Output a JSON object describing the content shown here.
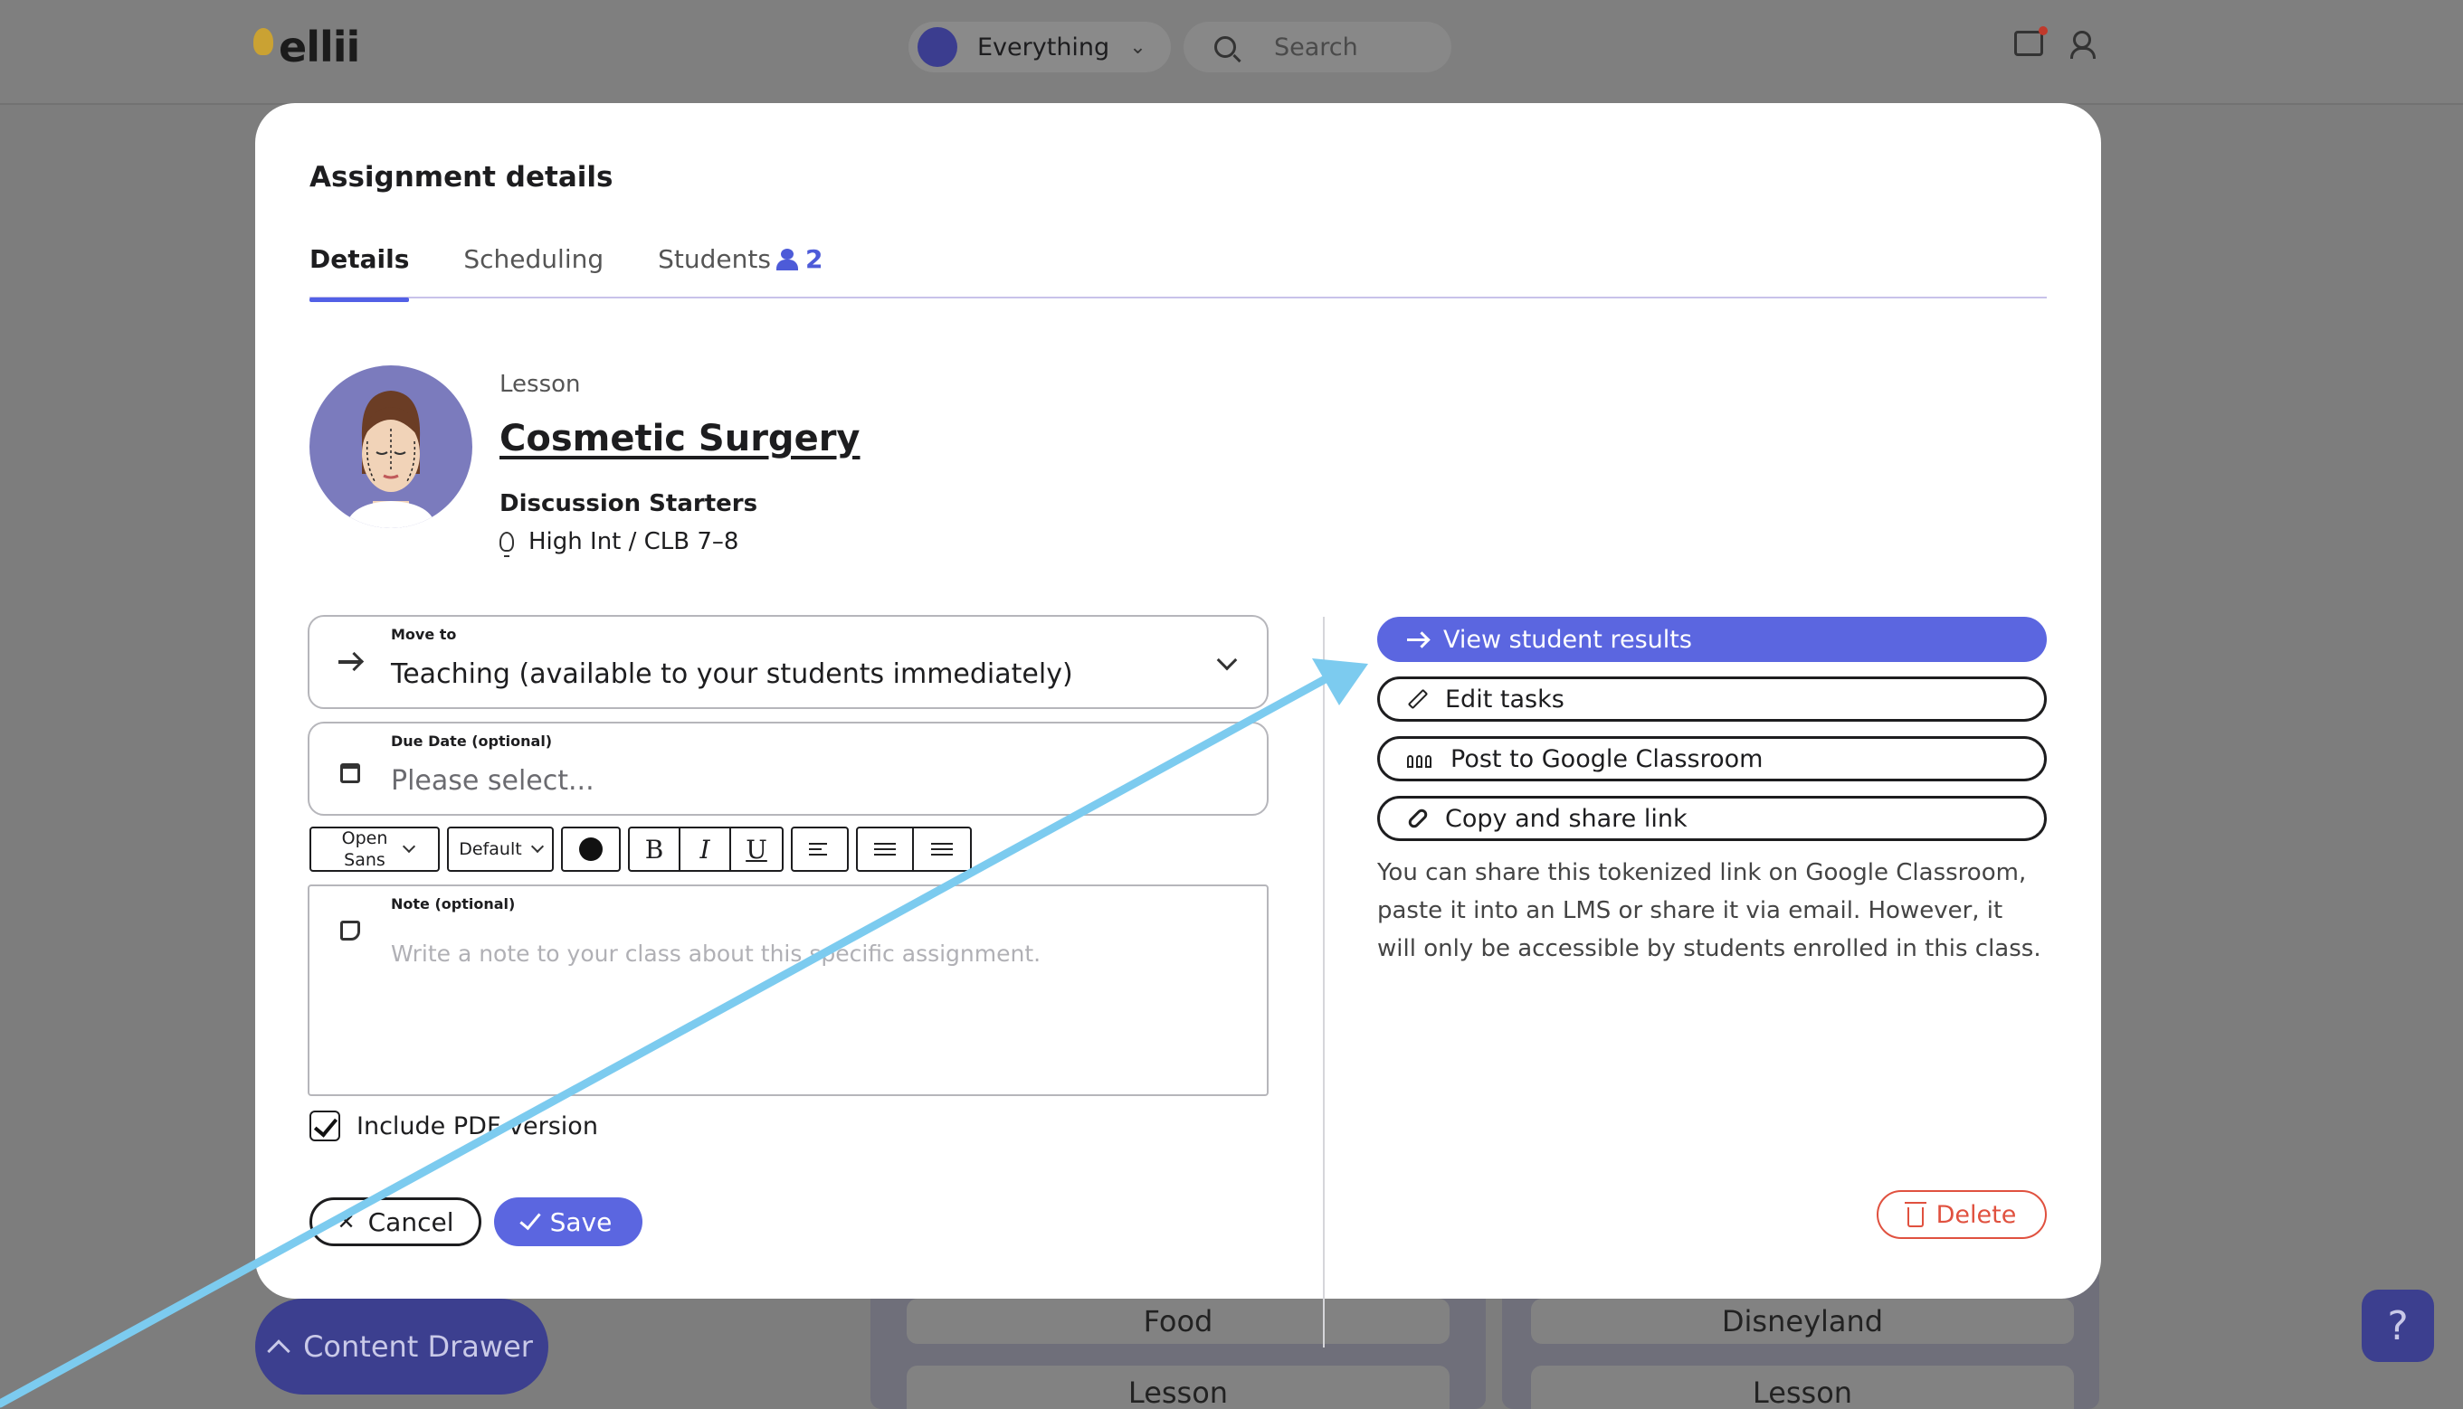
{
  "header": {
    "logo_text": "ellii",
    "scope_label": "Everything",
    "search_placeholder": "Search"
  },
  "background": {
    "cards": [
      "Food",
      "Disneyland",
      "Lesson",
      "Lesson"
    ],
    "content_drawer_label": "Content Drawer",
    "help_label": "?"
  },
  "modal": {
    "title": "Assignment details",
    "tabs": [
      {
        "label": "Details",
        "active": true
      },
      {
        "label": "Scheduling",
        "active": false
      },
      {
        "label": "Students",
        "count": "2",
        "active": false
      }
    ],
    "lesson": {
      "kind": "Lesson",
      "title": "Cosmetic Surgery",
      "category": "Discussion Starters",
      "level": "High Int / CLB 7–8"
    },
    "move_to": {
      "label": "Move to",
      "value": "Teaching (available to your students immediately)"
    },
    "due_date": {
      "label": "Due Date (optional)",
      "placeholder": "Please select..."
    },
    "toolbar": {
      "font_family": "Open Sans",
      "font_size": "Default",
      "bold": "B",
      "italic": "I",
      "underline": "U"
    },
    "note": {
      "label": "Note (optional)",
      "placeholder": "Write a note to your class about this specific assignment."
    },
    "include_pdf": {
      "label": "Include PDF version",
      "checked": true
    },
    "cancel_label": "Cancel",
    "save_label": "Save",
    "actions": {
      "view_results": "View student results",
      "edit_tasks": "Edit tasks",
      "post_classroom": "Post to Google Classroom",
      "copy_link": "Copy and share link"
    },
    "share_info": "You can share this tokenized link on Google Classroom, paste it into an LMS or share it via email. However, it will only be accessible by students enrolled in this class.",
    "delete_label": "Delete"
  },
  "colors": {
    "accent": "#5b66e0",
    "danger": "#e0513f",
    "annotation_arrow": "#7ccbef"
  }
}
